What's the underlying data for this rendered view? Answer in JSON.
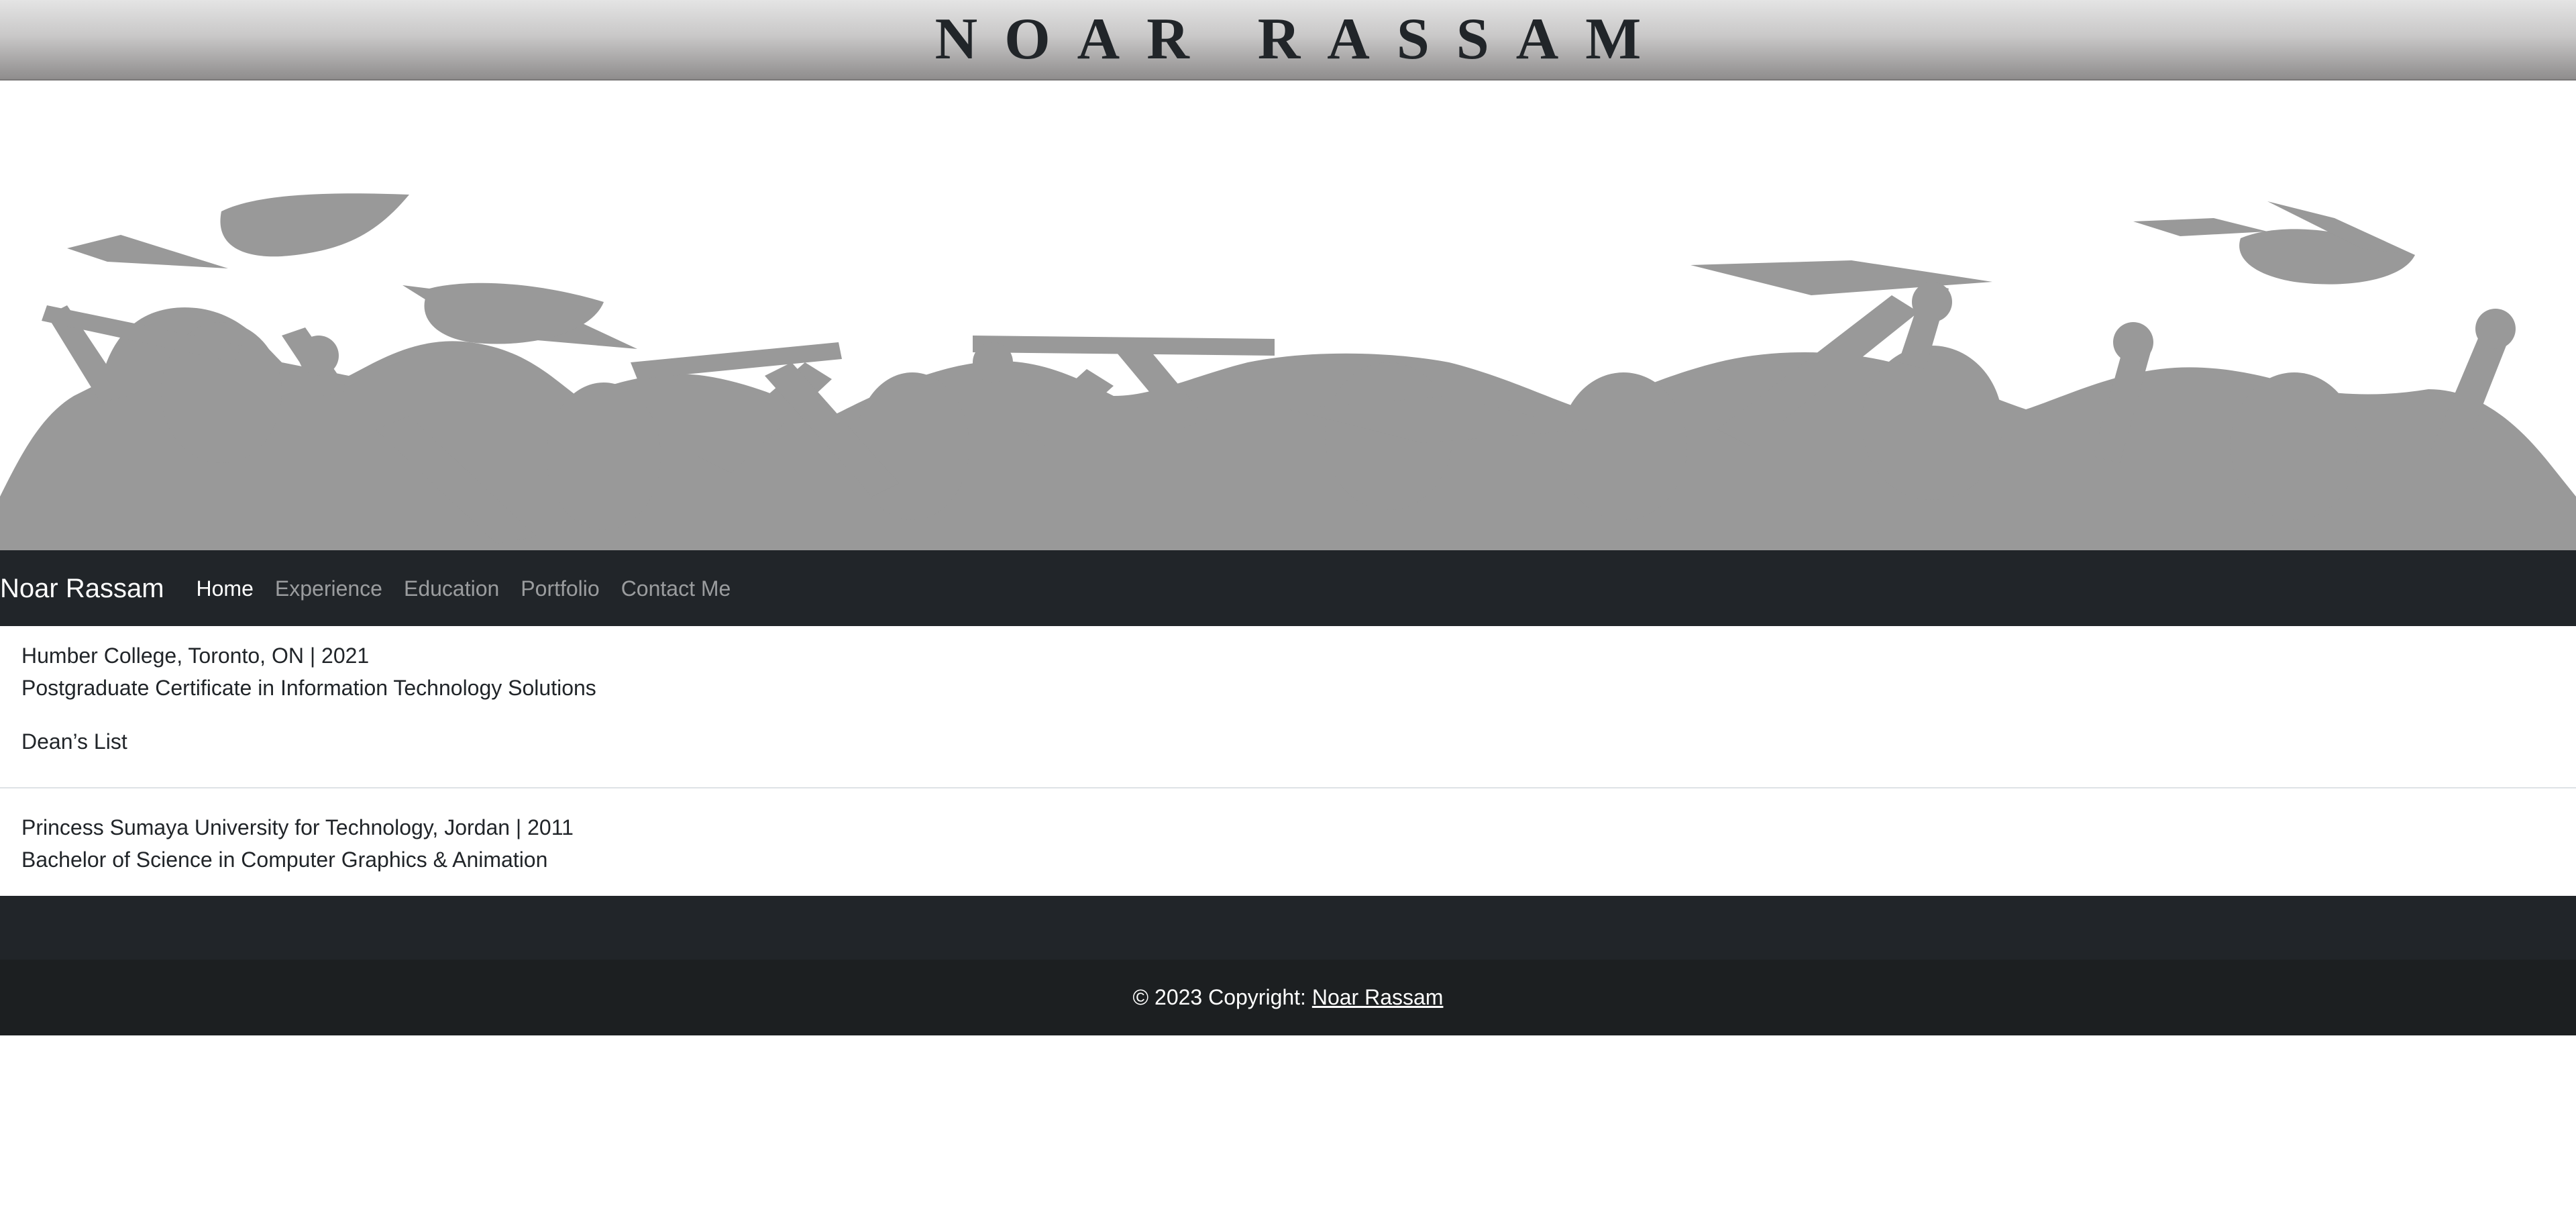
{
  "banner": {
    "title": "NOAR RASSAM"
  },
  "hero": {
    "image_desc_icon": "graduates-silhouette-icon",
    "silhouette_color": "#999999"
  },
  "navbar": {
    "brand": "Noar Rassam",
    "links": [
      {
        "label": "Home",
        "active": true
      },
      {
        "label": "Experience",
        "active": false
      },
      {
        "label": "Education",
        "active": false
      },
      {
        "label": "Portfolio",
        "active": false
      },
      {
        "label": "Contact Me",
        "active": false
      }
    ]
  },
  "education": [
    {
      "institution": "Humber College, Toronto, ON | 2021",
      "program": "Postgraduate Certificate in Information Technology Solutions",
      "honor": "Dean’s List"
    },
    {
      "institution": "Princess Sumaya University for Technology, Jordan | 2011",
      "program": "Bachelor of Science in Computer Graphics & Animation"
    }
  ],
  "footer": {
    "copyright_prefix": "© 2023 Copyright: ",
    "copyright_link": "Noar Rassam"
  },
  "colors": {
    "navbar_bg": "#212529",
    "footer_bottom_bg": "#1c1f21",
    "banner_gradient_top": "#e4e4e4",
    "banner_gradient_bottom": "#8f8d8d"
  }
}
